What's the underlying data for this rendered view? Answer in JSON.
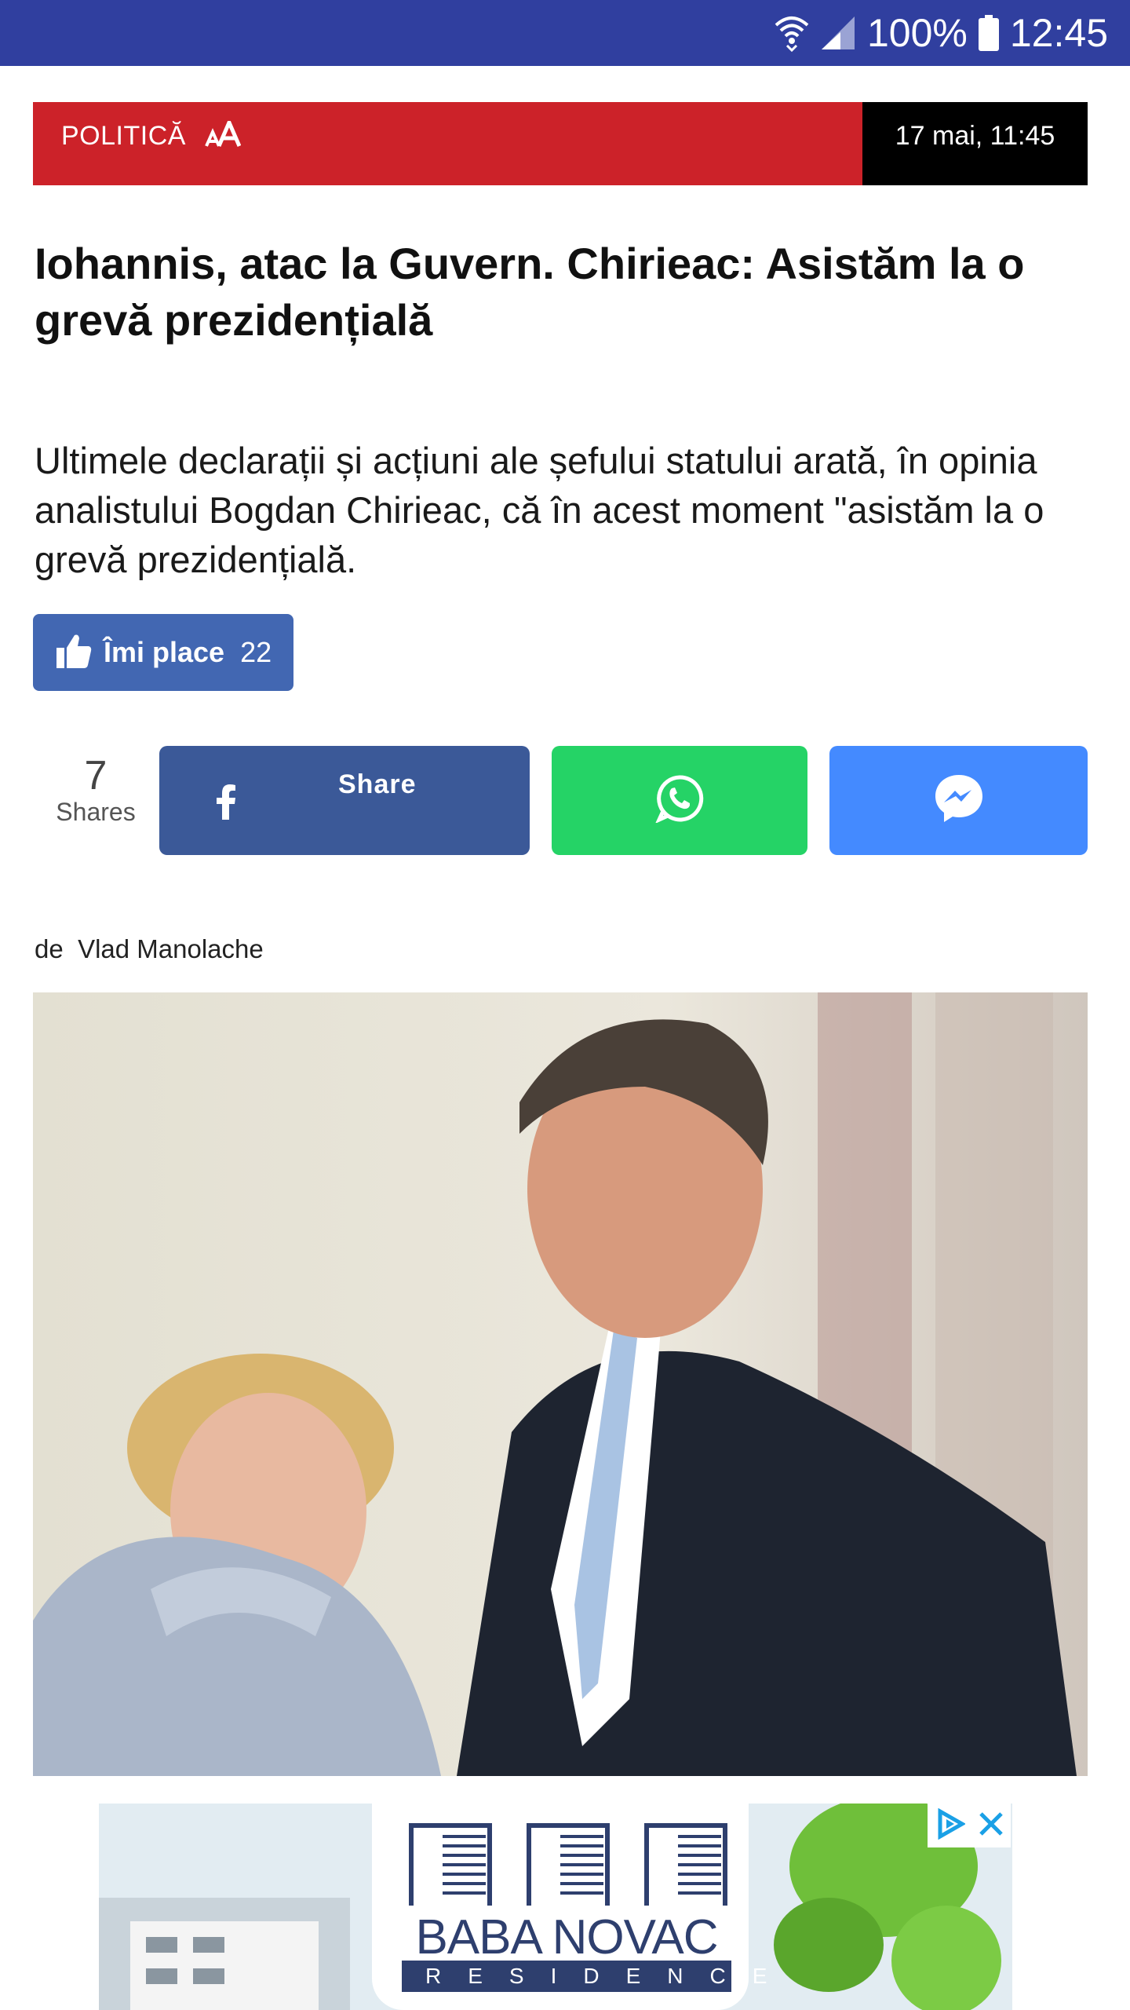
{
  "status_bar": {
    "battery": "100%",
    "time": "12:45",
    "icons": [
      "wifi-icon",
      "signal-icon",
      "battery-icon"
    ],
    "bg_color": "#303f9f"
  },
  "article": {
    "category": "POLITICĂ",
    "font_size_control": "AA",
    "date": "17 mai, 11:45",
    "title": "Iohannis, atac la Guvern. Chirieac: Asistăm la o grevă prezidențială",
    "lead": "Ultimele declarații și acțiuni ale șefului statului arată, în opinia analistului Bogdan Chirieac, că în acest moment \"asistăm la o grevă prezidențială.",
    "author_prefix": "de",
    "author": "Vlad Manolache",
    "category_color": "#cc2229"
  },
  "like": {
    "label": "Îmi place",
    "count": "22",
    "icon": "thumbs-up-icon",
    "color": "#4267b2"
  },
  "share": {
    "count": "7",
    "count_label": "Shares",
    "facebook_label": "Share",
    "buttons": [
      {
        "name": "facebook",
        "icon": "facebook-icon",
        "color": "#3b5998"
      },
      {
        "name": "whatsapp",
        "icon": "whatsapp-icon",
        "color": "#25d366"
      },
      {
        "name": "messenger",
        "icon": "messenger-icon",
        "color": "#448aff"
      }
    ]
  },
  "ad": {
    "brand": "BABA NOVAC",
    "sub": "RESIDENCE",
    "icons": [
      "adchoices-icon",
      "close-icon"
    ]
  }
}
